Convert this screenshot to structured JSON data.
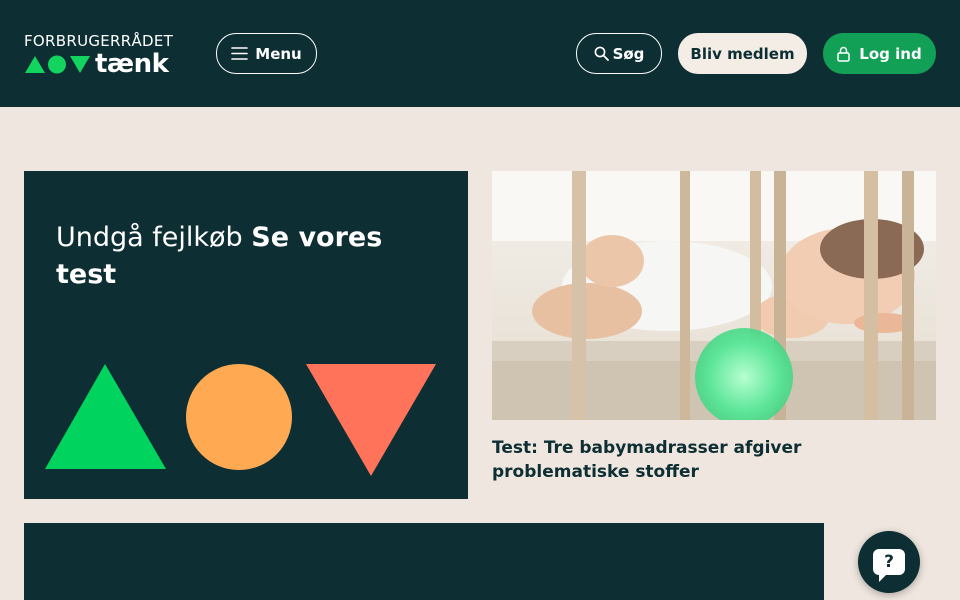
{
  "header": {
    "logo": {
      "top_text": "FORBRUGERRÅDET",
      "word": "tænk"
    },
    "menu_label": "Menu",
    "search_label": "Søg",
    "join_label": "Bliv medlem",
    "login_label": "Log ind"
  },
  "promo": {
    "title_light": "Undgå fejlkøb",
    "title_strong": "Se vores test"
  },
  "article": {
    "title": "Test: Tre babymadrasser afgiver problematiske stoffer"
  },
  "help": {
    "glyph": "?"
  },
  "colors": {
    "dark": "#0d2e33",
    "green": "#12a056",
    "shape_green": "#00d45e",
    "shape_orange": "#ffaa52",
    "shape_red": "#ff735a",
    "background": "#efe7df"
  },
  "icons": [
    "menu-icon",
    "search-icon",
    "lock-icon",
    "help-icon"
  ]
}
